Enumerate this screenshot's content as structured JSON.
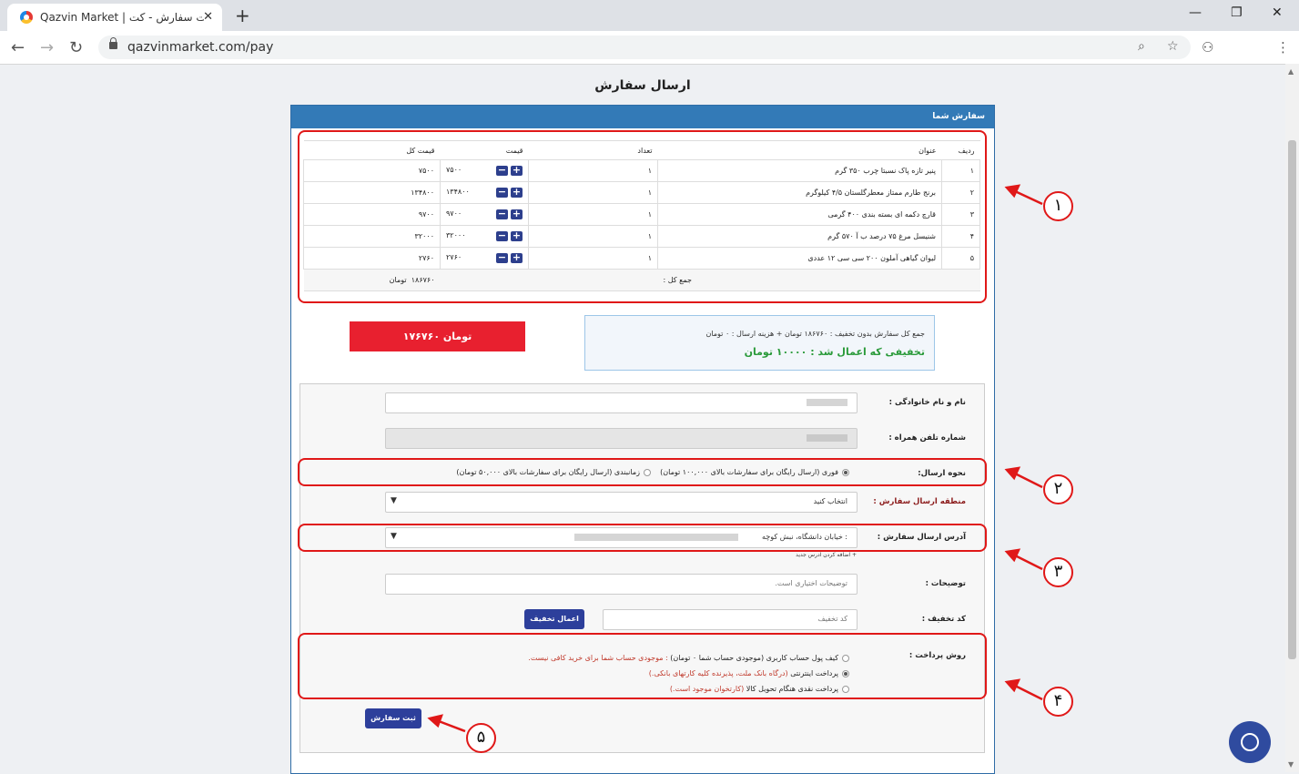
{
  "browser": {
    "tab_title": "Qazvin Market | ثبت سفارش - کت",
    "url": "qazvinmarket.com/pay"
  },
  "page": {
    "title": "ارسال سفارش",
    "panel_header": "سفارش شما"
  },
  "order_table": {
    "headers": {
      "row": "ردیف",
      "title": "عنوان",
      "qty": "تعداد",
      "price": "قیمت",
      "total": "قیمت کل"
    },
    "rows": [
      {
        "idx": "۱",
        "title": "پنیر تازه پاک نسبتا چرب ۳۵۰ گرم",
        "qty": "۱",
        "price": "۷۵۰۰",
        "total": "۷۵۰۰"
      },
      {
        "idx": "۲",
        "title": "برنج طارم ممتاز معطرگلستان ۴/۵ کیلوگرم",
        "qty": "۱",
        "price": "۱۳۴۸۰۰",
        "total": "۱۳۴۸۰۰"
      },
      {
        "idx": "۳",
        "title": "قارچ دکمه ای بسته بندی ۴۰۰ گرمی",
        "qty": "۱",
        "price": "۹۷۰۰",
        "total": "۹۷۰۰"
      },
      {
        "idx": "۴",
        "title": "شنیسل مرغ ۷۵ درصد ب آ ۵۷۰ گرم",
        "qty": "۱",
        "price": "۳۲۰۰۰",
        "total": "۳۲۰۰۰"
      },
      {
        "idx": "۵",
        "title": "لیوان گیاهی آملون ۲۰۰ سی سی ۱۲ عددی",
        "qty": "۱",
        "price": "۲۷۶۰",
        "total": "۲۷۶۰"
      }
    ],
    "sum_label": "جمع کل :",
    "sum_value": "۱۸۶۷۶۰",
    "sum_unit": "تومان"
  },
  "summary": {
    "line1": "جمع کل سفارش بدون تخفیف : ۱۸۶۷۶۰ تومان + هزینه ارسال : ۰ تومان",
    "line2": "تخفیفی که اعمال شد : ۱۰۰۰۰ تومان",
    "final_total": "۱۷۶۷۶۰ تومان"
  },
  "form": {
    "name_label": "نام و نام خانوادگی :",
    "phone_label": "شماره تلفن همراه :",
    "shipping_label": "نحوه ارسال:",
    "shipping_options": [
      {
        "label": "فوری (ارسال رایگان برای سفارشات بالای ۱۰۰,۰۰۰ تومان)",
        "selected": true
      },
      {
        "label": "زمانبندی (ارسال رایگان برای سفارشات بالای ۵۰,۰۰۰ تومان)",
        "selected": false
      }
    ],
    "region_label": "منطقه ارسال سفارش :",
    "region_value": "انتخاب کنید",
    "address_label": "آدرس ارسال سفارش :",
    "address_value": ": خیابان دانشگاه، نبش کوچه",
    "add_address": "+ اضافه کردن آدرس جدید",
    "notes_label": "توضیحات :",
    "notes_placeholder": "توضیحات اختیاری است.",
    "discount_label": "کد تخفیف :",
    "discount_placeholder": "کد تخفیف",
    "apply_discount": "اعمال تخفیف",
    "payment_label": "روش پرداخت :",
    "payment_options": [
      {
        "label": "کیف پول حساب کاربری (موجودی حساب شما ۰ تومان)",
        "note": " : موجودی حساب شما برای خرید کافی نیست.",
        "selected": false
      },
      {
        "label": "پرداخت اینترنتی",
        "note": " (درگاه بانک ملت، پذیرنده کلیه کارتهای بانکی.)",
        "selected": true
      },
      {
        "label": "پرداخت نقدی هنگام تحویل کالا",
        "note": " (کارتخوان موجود است.)",
        "selected": false
      }
    ],
    "submit": "ثبت سفارش"
  },
  "callouts": [
    "۱",
    "۲",
    "۳",
    "۴",
    "۵"
  ],
  "colors": {
    "accent": "#337ab7",
    "button": "#2d3f9b",
    "total_red": "#e8202f",
    "discount_green": "#2a9a3a",
    "annotation": "#e01818"
  }
}
